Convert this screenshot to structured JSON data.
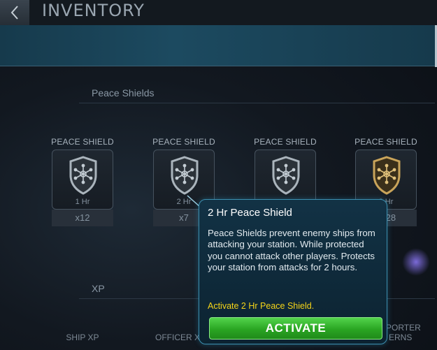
{
  "header": {
    "title": "INVENTORY",
    "back_icon": "chevron-left-icon"
  },
  "sections": {
    "peace_shields": "Peace Shields",
    "xp": "XP"
  },
  "items": [
    {
      "name": "PEACE SHIELD",
      "duration": "1 Hr",
      "count": "x12",
      "color": "#b9c2c9"
    },
    {
      "name": "PEACE SHIELD",
      "duration": "2 Hr",
      "count": "x7",
      "color": "#b9c2c9"
    },
    {
      "name": "PEACE SHIELD",
      "duration": "",
      "count": "",
      "color": "#b9c2c9"
    },
    {
      "name": "PEACE SHIELD",
      "duration": "8 Hr",
      "count": "x328",
      "color": "#c9a45a"
    }
  ],
  "bottom_items": {
    "ship_xp": "SHIP XP",
    "officer_xp": "OFFICER X",
    "porter": "PORTER",
    "erns": "ERNS"
  },
  "tooltip": {
    "title": "2 Hr Peace Shield",
    "description": "Peace Shields prevent enemy ships from attacking your station. While protected you cannot attack other players. Protects your station from attacks for 2 hours.",
    "action_text": "Activate 2 Hr Peace Shield.",
    "button_label": "ACTIVATE"
  }
}
